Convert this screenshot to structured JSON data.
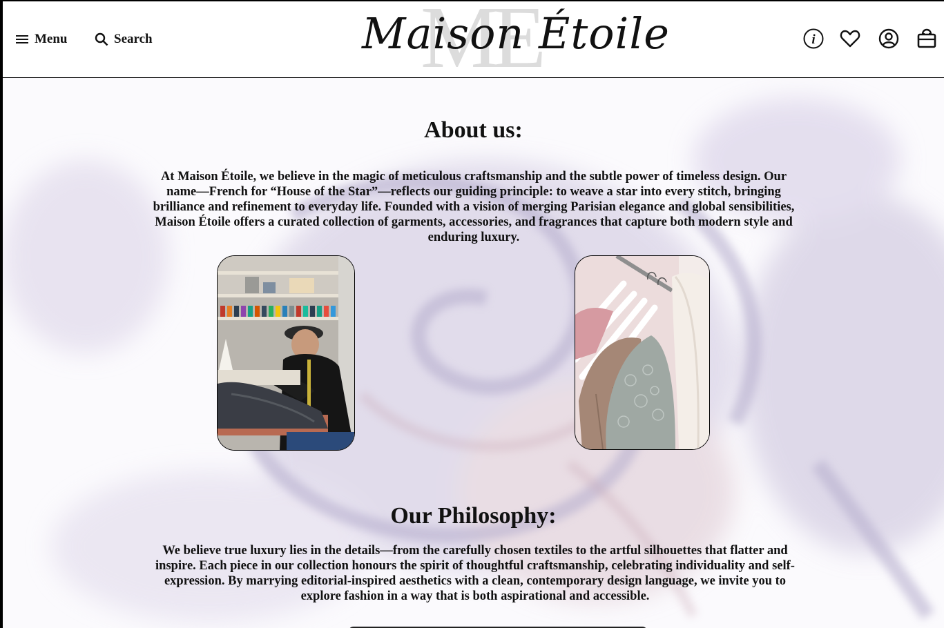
{
  "header": {
    "menu_label": "Menu",
    "search_label": "Search",
    "brand_name": "Maison Étoile",
    "brand_monogram": "ME",
    "icons": [
      "info-icon",
      "heart-icon",
      "account-icon",
      "bag-icon"
    ]
  },
  "about": {
    "heading": "About us:",
    "body": "At Maison Étoile, we believe in the magic of meticulous craftsmanship and the subtle power of timeless design. Our name—French for “House of the Star”—reflects our guiding principle: to weave a star into every stitch, bringing brilliance and refinement to everyday life. Founded with a vision of merging Parisian elegance and global sensibilities, Maison Étoile offers a curated collection of garments, accessories, and fragrances that capture both modern style and enduring luxury."
  },
  "philosophy": {
    "heading": "Our Philosophy:",
    "body": "We believe true luxury lies in the details—from the carefully chosen textiles to the artful silhouettes that flatter and inspire. Each piece in our collection honours the spirit of thoughtful craftsmanship, celebrating individuality and self-expression. By marrying editorial-inspired aesthetics with a clean, contemporary design language, we invite you to explore fashion in a way that is both aspirational and accessible."
  },
  "colors": {
    "text": "#111111",
    "background": "#fdfcfe",
    "accent_lavender": "#c9c3dc"
  }
}
